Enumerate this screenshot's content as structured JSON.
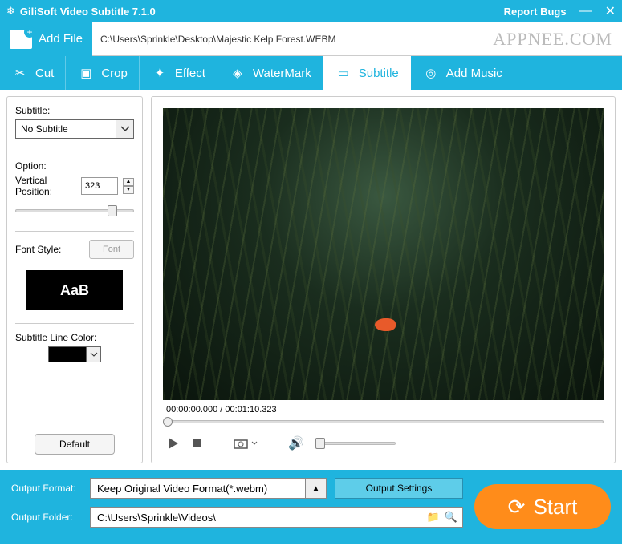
{
  "titlebar": {
    "title": "GiliSoft Video Subtitle 7.1.0",
    "report": "Report Bugs"
  },
  "filebar": {
    "addfile": "Add File",
    "path": "C:\\Users\\Sprinkle\\Desktop\\Majestic Kelp Forest.WEBM",
    "watermark": "APPNEE.COM"
  },
  "tabs": {
    "cut": "Cut",
    "crop": "Crop",
    "effect": "Effect",
    "watermark": "WaterMark",
    "subtitle": "Subtitle",
    "addmusic": "Add Music"
  },
  "sidebar": {
    "subtitle_label": "Subtitle:",
    "subtitle_value": "No Subtitle",
    "option_label": "Option:",
    "vpos_label": "Vertical Position:",
    "vpos_value": "323",
    "fontstyle_label": "Font Style:",
    "font_button": "Font",
    "preview_text": "AaB",
    "linecolor_label": "Subtitle Line Color:",
    "default_button": "Default"
  },
  "player": {
    "timecode": "00:00:00.000 / 00:01:10.323"
  },
  "bottom": {
    "format_label": "Output Format:",
    "format_value": "Keep Original Video Format(*.webm)",
    "settings_button": "Output Settings",
    "folder_label": "Output Folder:",
    "folder_value": "C:\\Users\\Sprinkle\\Videos\\",
    "start_button": "Start"
  }
}
